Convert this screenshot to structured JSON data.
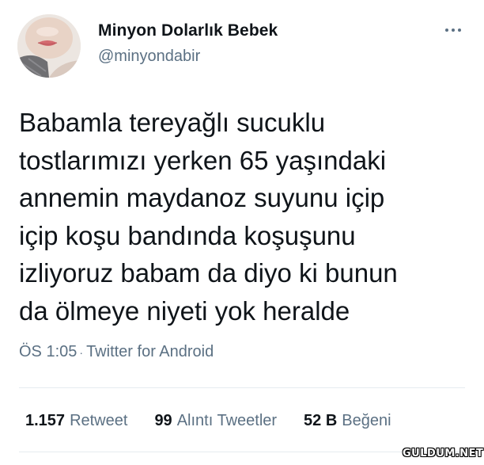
{
  "user": {
    "display_name": "Minyon Dolarlık Bebek",
    "handle": "@minyondabir"
  },
  "more_icon": "more-horizontal-icon",
  "tweet": {
    "lines": [
      "Babamla tereyağlı sucuklu",
      "tostlarımızı yerken 65 yaşındaki",
      "annemin maydanoz suyunu içip",
      "içip koşu bandında koşuşunu",
      "izliyoruz babam da diyo ki bunun",
      "da ölmeye niyeti yok heralde"
    ],
    "time": "ÖS 1:05",
    "separator": "·",
    "source": "Twitter for Android"
  },
  "stats": {
    "retweets": {
      "count": "1.157",
      "label": "Retweet"
    },
    "quotes": {
      "count": "99",
      "label": "Alıntı Tweetler"
    },
    "likes": {
      "count": "52 B",
      "label": "Beğeni"
    }
  },
  "watermark": "GULDUM.NET",
  "colors": {
    "text": "#0f1419",
    "secondary": "#5b7083",
    "divider": "#e6ecf0",
    "background": "#ffffff"
  }
}
